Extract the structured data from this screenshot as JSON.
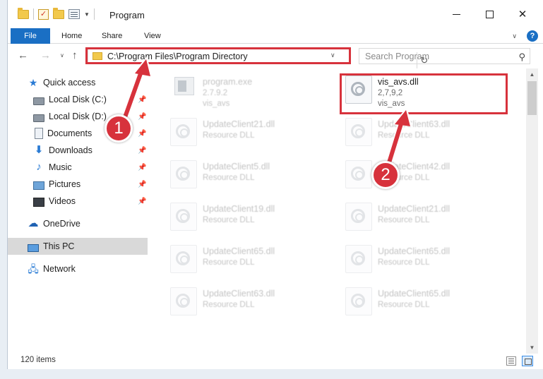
{
  "window": {
    "title": "Program"
  },
  "ribbon": {
    "tabs": [
      "File",
      "Home",
      "Share",
      "View"
    ]
  },
  "address_bar": {
    "path": "C:\\Program Files\\Program Directory"
  },
  "search": {
    "placeholder": "Search Program"
  },
  "sidebar": {
    "quick_access": "Quick access",
    "items": [
      {
        "label": "Local Disk (C:)",
        "icon": "drive-icon",
        "pinned": true
      },
      {
        "label": "Local Disk (D:)",
        "icon": "drive-icon",
        "pinned": true
      },
      {
        "label": "Documents",
        "icon": "documents-icon",
        "pinned": true
      },
      {
        "label": "Downloads",
        "icon": "downloads-icon",
        "pinned": true
      },
      {
        "label": "Music",
        "icon": "music-icon",
        "pinned": true
      },
      {
        "label": "Pictures",
        "icon": "pictures-icon",
        "pinned": true
      },
      {
        "label": "Videos",
        "icon": "videos-icon",
        "pinned": true
      }
    ],
    "onedrive": "OneDrive",
    "this_pc": "This PC",
    "network": "Network"
  },
  "files": [
    {
      "name": "program.exe",
      "line2": "2.7.9.2",
      "line3": "vis_avs",
      "faded": true
    },
    {
      "name": "vis_avs.dll",
      "line2": "2,7,9,2",
      "line3": "vis_avs",
      "faded": false
    },
    {
      "name": "UpdateClient21.dll",
      "line2": "Resource DLL",
      "faded": true
    },
    {
      "name": "UpdateClient63.dll",
      "line2": "Resource DLL",
      "faded": true
    },
    {
      "name": "UpdateClient5.dll",
      "line2": "Resource DLL",
      "faded": true
    },
    {
      "name": "UpdateClient42.dll",
      "line2": "Resource DLL",
      "faded": true
    },
    {
      "name": "UpdateClient19.dll",
      "line2": "Resource DLL",
      "faded": true
    },
    {
      "name": "UpdateClient21.dll",
      "line2": "Resource DLL",
      "faded": true
    },
    {
      "name": "UpdateClient65.dll",
      "line2": "Resource DLL",
      "faded": true
    },
    {
      "name": "UpdateClient65.dll",
      "line2": "Resource DLL",
      "faded": true
    },
    {
      "name": "UpdateClient63.dll",
      "line2": "Resource DLL",
      "faded": true
    },
    {
      "name": "UpdateClient65.dll",
      "line2": "Resource DLL",
      "faded": true
    }
  ],
  "status": {
    "item_count": "120 items"
  },
  "annotations": {
    "badge_1": "1",
    "badge_2": "2",
    "color": "#d7323c"
  }
}
